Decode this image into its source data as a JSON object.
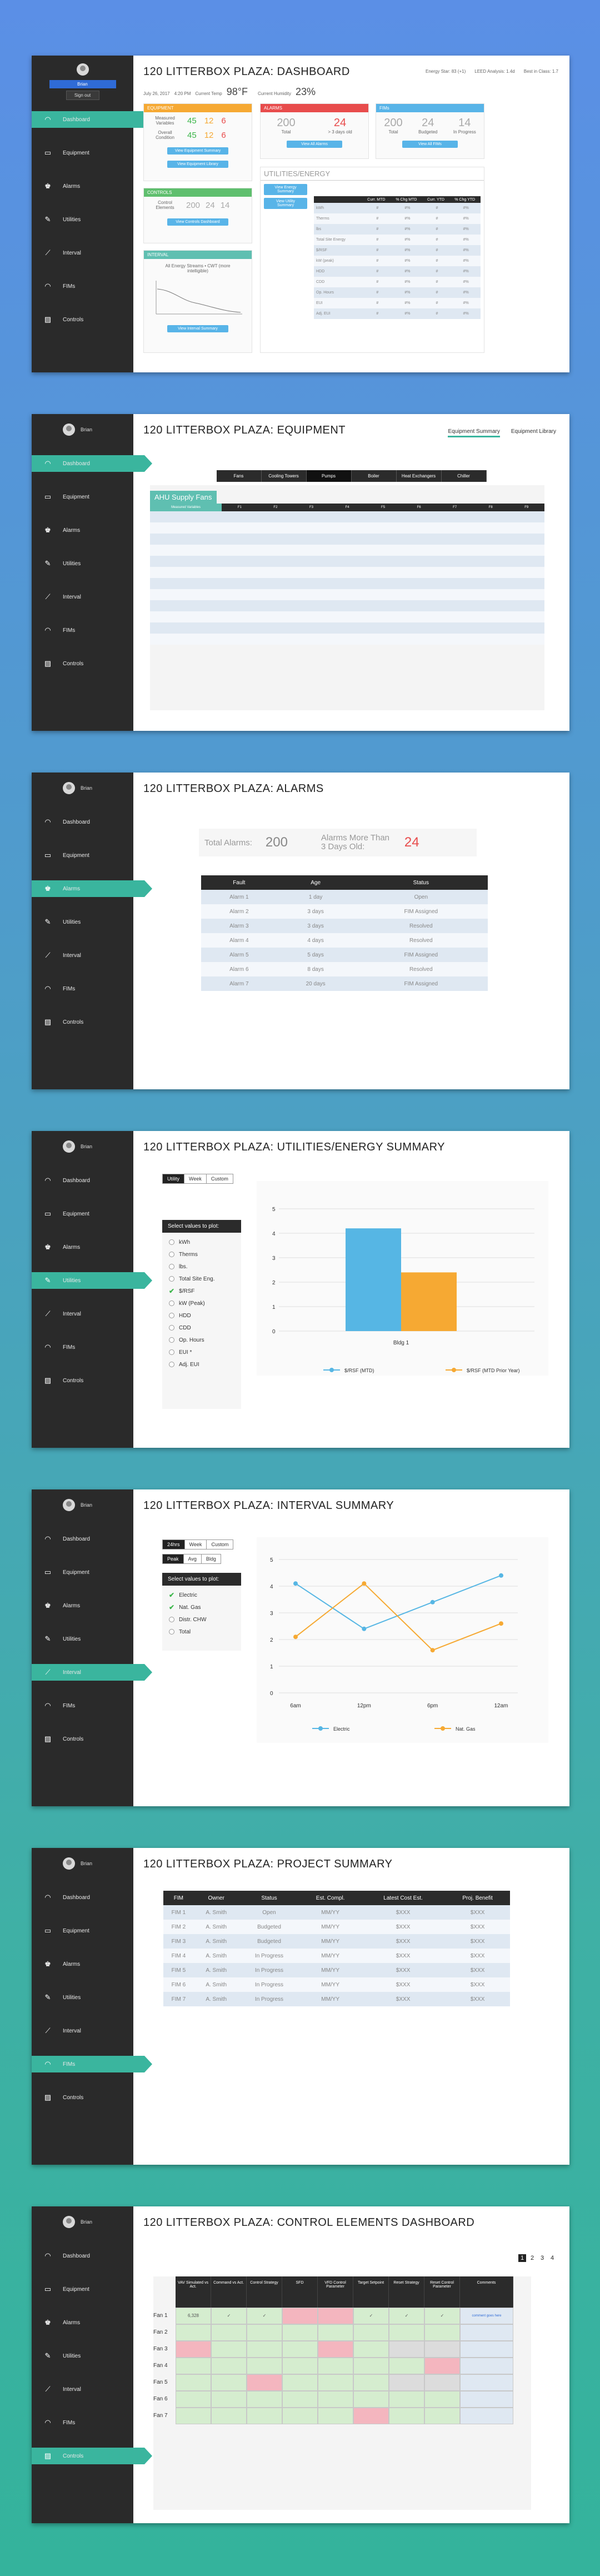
{
  "common": {
    "user": "Brian",
    "nav": [
      "Dashboard",
      "Equipment",
      "Alarms",
      "Utilities",
      "Interval",
      "FIMs",
      "Controls"
    ],
    "nav_icons": [
      "gauge-icon",
      "equipment-icon",
      "alarm-icon",
      "wrench-icon",
      "line-chart-icon",
      "gauge-icon",
      "controls-icon"
    ],
    "accent": "#3ab59e"
  },
  "dashboard": {
    "title": "120 LITTERBOX PLAZA: DASHBOARD",
    "user_menu": [
      "Brian",
      "Sign out"
    ],
    "header_links": [
      "Energy Star: 83 (+1)",
      "LEED Analysis: 1.4d",
      "Best in Class: 1.7"
    ],
    "date": "July 26, 2017",
    "time": "4:20 PM",
    "temp_label": "Current Temp",
    "temp": "98°F",
    "humidity_label": "Current Humidity",
    "humidity": "23%",
    "equipment": {
      "title": "EQUIPMENT",
      "rows": [
        {
          "label": "Measured Variables",
          "vals": [
            "45",
            "12",
            "6"
          ]
        },
        {
          "label": "Overall Condition",
          "vals": [
            "45",
            "12",
            "6"
          ]
        }
      ],
      "buttons": [
        "View Equipment Summary",
        "View Equipment Library"
      ]
    },
    "controls": {
      "title": "CONTROLS",
      "row_label": "Control Elements",
      "vals": [
        "200",
        "24",
        "14"
      ],
      "button": "View Controls Dashboard"
    },
    "interval": {
      "title": "INTERVAL",
      "chart_caption": "All Energy Streams • CWT (more intelligible)",
      "button": "View Interval Summary"
    },
    "alarms": {
      "title": "ALARMS",
      "stats": [
        {
          "value": "200",
          "label": "Total"
        },
        {
          "value": "24",
          "label": "> 3 days old"
        }
      ],
      "button": "View All Alarms"
    },
    "fims": {
      "title": "FIMs",
      "stats": [
        {
          "value": "200",
          "label": "Total"
        },
        {
          "value": "24",
          "label": "Budgeted"
        },
        {
          "value": "14",
          "label": "In Progress"
        }
      ],
      "button": "View All FIMs"
    },
    "utilities": {
      "title": "UTILITIES/ENERGY",
      "buttons": [
        "View Energy Summary",
        "View Utility Summary"
      ],
      "columns": [
        "",
        "Curr. MTD",
        "% Chg MTD",
        "Curr. YTD",
        "% Chg YTD"
      ],
      "rows": [
        [
          "kWh",
          "#",
          "#%",
          "#",
          "#%"
        ],
        [
          "Therms",
          "#",
          "#%",
          "#",
          "#%"
        ],
        [
          "lbs",
          "#",
          "#%",
          "#",
          "#%"
        ],
        [
          "Total Site Energy",
          "#",
          "#%",
          "#",
          "#%"
        ],
        [
          "$/RSF",
          "#",
          "#%",
          "#",
          "#%"
        ],
        [
          "kW (peak)",
          "#",
          "#%",
          "#",
          "#%"
        ],
        [
          "HDD",
          "#",
          "#%",
          "#",
          "#%"
        ],
        [
          "CDD",
          "#",
          "#%",
          "#",
          "#%"
        ],
        [
          "Op. Hours",
          "#",
          "#%",
          "#",
          "#%"
        ],
        [
          "EUI",
          "#",
          "#%",
          "#",
          "#%"
        ],
        [
          "Adj. EUI",
          "#",
          "#%",
          "#",
          "#%"
        ]
      ]
    }
  },
  "equipment": {
    "title": "120 LITTERBOX PLAZA: EQUIPMENT",
    "tabs": [
      "Equipment Summary",
      "Equipment Library"
    ],
    "type_tabs": [
      "Fans",
      "Cooling Towers",
      "Pumps",
      "Boiler",
      "Heat Exchangers",
      "Chiller"
    ],
    "section": "AHU Supply Fans",
    "columns": [
      "Measured Variables",
      "F1",
      "F2",
      "F3",
      "F4",
      "F5",
      "F6",
      "F7",
      "F8",
      "F9"
    ],
    "row_count": 12
  },
  "alarms": {
    "title": "120 LITTERBOX PLAZA: ALARMS",
    "total_label": "Total Alarms:",
    "total": "200",
    "old_label": "Alarms More Than 3 Days Old:",
    "old": "24",
    "columns": [
      "Fault",
      "Age",
      "Status"
    ],
    "rows": [
      [
        "Alarm 1",
        "1 day",
        "Open"
      ],
      [
        "Alarm 2",
        "3 days",
        "FIM Assigned"
      ],
      [
        "Alarm 3",
        "3 days",
        "Resolved"
      ],
      [
        "Alarm 4",
        "4 days",
        "Resolved"
      ],
      [
        "Alarm 5",
        "5 days",
        "FIM Assigned"
      ],
      [
        "Alarm 6",
        "8 days",
        "Resolved"
      ],
      [
        "Alarm 7",
        "20 days",
        "FIM Assigned"
      ]
    ]
  },
  "utilities": {
    "title": "120 LITTERBOX PLAZA: UTILITIES/ENERGY SUMMARY",
    "segments": [
      "Utility",
      "Week",
      "Custom"
    ],
    "select_label": "Select values to plot:",
    "options": [
      {
        "label": "kWh",
        "checked": false
      },
      {
        "label": "Therms",
        "checked": false
      },
      {
        "label": "lbs.",
        "checked": false
      },
      {
        "label": "Total Site Eng.",
        "checked": false
      },
      {
        "label": "$/RSF",
        "checked": true
      },
      {
        "label": "kW (Peak)",
        "checked": false
      },
      {
        "label": "HDD",
        "checked": false
      },
      {
        "label": "CDD",
        "checked": false
      },
      {
        "label": "Op. Hours",
        "checked": false
      },
      {
        "label": "EUI *",
        "checked": false
      },
      {
        "label": "Adj. EUI",
        "checked": false
      }
    ]
  },
  "interval": {
    "title": "120 LITTERBOX PLAZA: INTERVAL SUMMARY",
    "segments1": [
      "24hrs",
      "Week",
      "Custom"
    ],
    "segments2": [
      "Peak",
      "Avg",
      "Bldg"
    ],
    "select_label": "Select values to plot:",
    "options": [
      {
        "label": "Electric",
        "checked": true
      },
      {
        "label": "Nat. Gas",
        "checked": true
      },
      {
        "label": "Distr. CHW",
        "checked": false
      },
      {
        "label": "Total",
        "checked": false
      }
    ]
  },
  "fims": {
    "title": "120 LITTERBOX PLAZA: PROJECT SUMMARY",
    "columns": [
      "FIM",
      "Owner",
      "Status",
      "Est. Compl.",
      "Latest Cost Est.",
      "Proj. Benefit"
    ],
    "rows": [
      [
        "FIM 1",
        "A. Smith",
        "Open",
        "MM/YY",
        "$XXX",
        "$XXX"
      ],
      [
        "FIM 2",
        "A. Smith",
        "Budgeted",
        "MM/YY",
        "$XXX",
        "$XXX"
      ],
      [
        "FIM 3",
        "A. Smith",
        "Budgeted",
        "MM/YY",
        "$XXX",
        "$XXX"
      ],
      [
        "FIM 4",
        "A. Smith",
        "In Progress",
        "MM/YY",
        "$XXX",
        "$XXX"
      ],
      [
        "FIM 5",
        "A. Smith",
        "In Progress",
        "MM/YY",
        "$XXX",
        "$XXX"
      ],
      [
        "FIM 6",
        "A. Smith",
        "In Progress",
        "MM/YY",
        "$XXX",
        "$XXX"
      ],
      [
        "FIM 7",
        "A. Smith",
        "In Progress",
        "MM/YY",
        "$XXX",
        "$XXX"
      ]
    ]
  },
  "controls": {
    "title": "120 LITTERBOX PLAZA: CONTROL ELEMENTS DASHBOARD",
    "pages": [
      "1",
      "2",
      "3",
      "4"
    ],
    "columns": [
      "VAV Simulated vs Act.",
      "Command vs Act.",
      "Control Strategy",
      "SFD",
      "VFD Control Parameter",
      "Target Setpoint",
      "Reset Strategy",
      "Reset Control Parameter",
      "Comments"
    ],
    "rows": [
      "Fan 1",
      "Fan 2",
      "Fan 3",
      "Fan 4",
      "Fan 5",
      "Fan 6",
      "Fan 7"
    ],
    "first_value": "6,328",
    "comment_link": "comment goes here",
    "cells": [
      [
        "v",
        "c",
        "c",
        "r",
        "r",
        "c",
        "c",
        "c"
      ],
      [
        "g",
        "g",
        "g",
        "g",
        "g",
        "g",
        "g",
        "g"
      ],
      [
        "r",
        "g",
        "g",
        "g",
        "r",
        "g",
        "x",
        "x"
      ],
      [
        "g",
        "g",
        "g",
        "g",
        "g",
        "g",
        "g",
        "r"
      ],
      [
        "g",
        "g",
        "r",
        "g",
        "g",
        "g",
        "x",
        "x"
      ],
      [
        "g",
        "g",
        "g",
        "g",
        "g",
        "g",
        "g",
        "g"
      ],
      [
        "g",
        "g",
        "g",
        "g",
        "g",
        "r",
        "g",
        "g"
      ]
    ]
  },
  "chart_data": [
    {
      "type": "bar",
      "categories": [
        "Bldg 1"
      ],
      "series": [
        {
          "name": "$/RSF (MTD)",
          "values": [
            4.2
          ],
          "color": "#56b6e4"
        },
        {
          "name": "$/RSF (MTD Prior Year)",
          "values": [
            2.4
          ],
          "color": "#f6a933"
        }
      ],
      "ylim": [
        0,
        5
      ],
      "yticks": [
        "0",
        "1",
        "2",
        "3",
        "4",
        "5"
      ],
      "legend": "bottom"
    },
    {
      "type": "line",
      "categories": [
        "6am",
        "12pm",
        "6pm",
        "12am"
      ],
      "x_points": [
        0,
        0.25,
        0.5,
        0.75,
        1.0
      ],
      "series": [
        {
          "name": "Electric",
          "values": [
            4.1,
            2.4,
            3.4,
            4.4
          ],
          "color": "#56b6e4"
        },
        {
          "name": "Nat. Gas",
          "values": [
            2.1,
            4.1,
            1.6,
            2.6
          ],
          "color": "#f6a933"
        }
      ],
      "ylim": [
        0,
        5
      ],
      "yticks": [
        "0",
        "1",
        "2",
        "3",
        "4",
        "5"
      ],
      "legend": "bottom"
    }
  ]
}
